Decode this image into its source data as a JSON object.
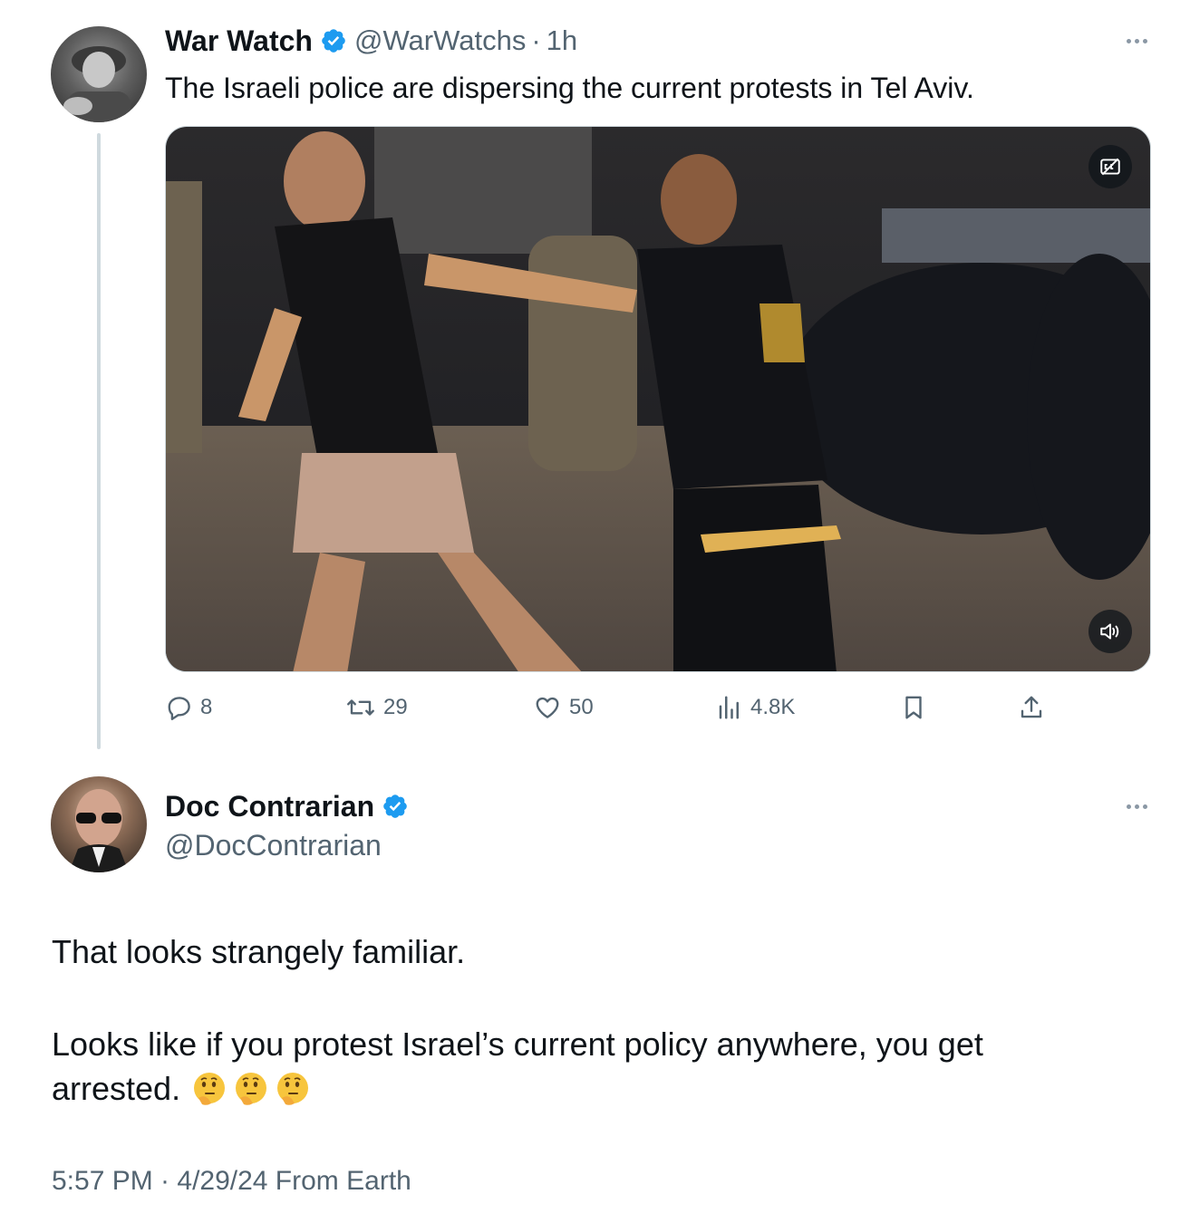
{
  "tweet1": {
    "display_name": "War Watch",
    "handle": "@WarWatchs",
    "separator": "·",
    "time": "1h",
    "text": "The Israeli police are dispersing the current protests in Tel Aviv.",
    "stats": {
      "replies": "8",
      "reposts": "29",
      "likes": "50",
      "views": "4.8K"
    }
  },
  "tweet2": {
    "display_name": "Doc Contrarian",
    "handle": "@DocContrarian",
    "line1": "That looks strangely familiar.",
    "line2": "Looks like if you protest Israel’s current policy anywhere, you get",
    "line3": "arrested.",
    "emojis": [
      "thinking-face",
      "thinking-face",
      "thinking-face"
    ],
    "footer": "5:57 PM · 4/29/24 From Earth"
  },
  "colors": {
    "text": "#0f1419",
    "secondary": "#536471",
    "verified": "#1d9bf0",
    "thread_line": "#cfd9de"
  }
}
